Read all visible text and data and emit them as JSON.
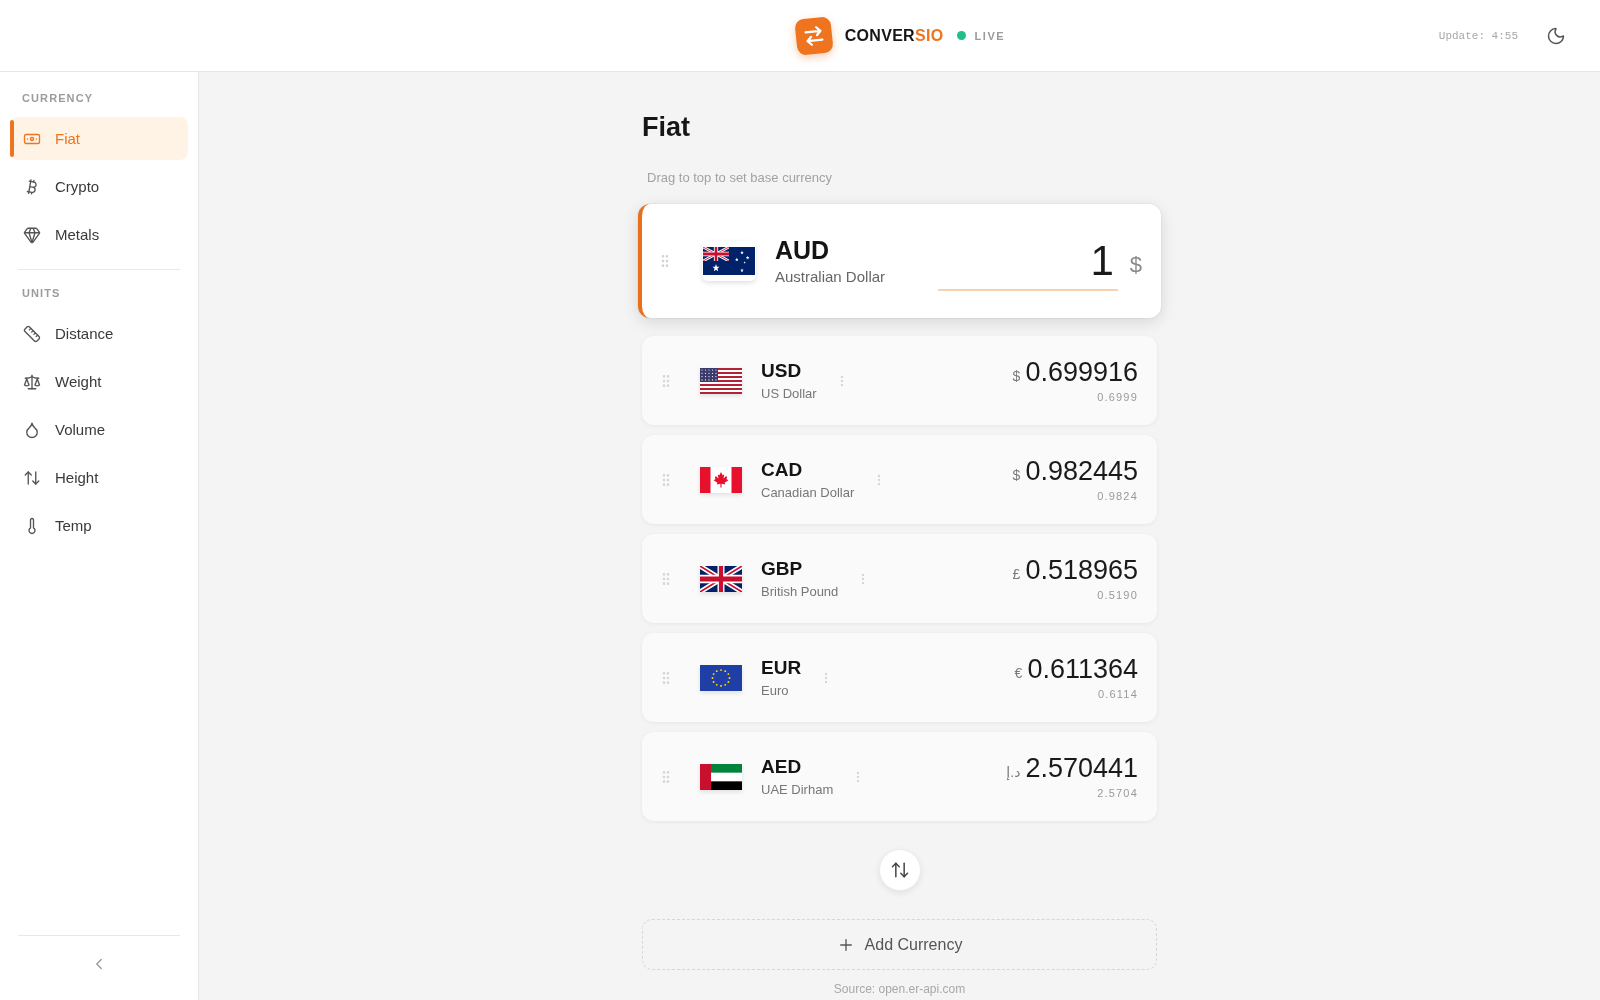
{
  "header": {
    "brand": {
      "text": "CONVER",
      "accent": "SIO"
    },
    "status": {
      "label": "LIVE",
      "on": true
    },
    "update": "Update: 4:55"
  },
  "sidebar": {
    "sections": [
      {
        "title": "CURRENCY",
        "items": [
          {
            "label": "Fiat",
            "selected": true
          },
          {
            "label": "Crypto",
            "selected": false
          },
          {
            "label": "Metals",
            "selected": false
          }
        ]
      },
      {
        "title": "UNITS",
        "items": [
          {
            "label": "Distance",
            "selected": false
          },
          {
            "label": "Weight",
            "selected": false
          },
          {
            "label": "Volume",
            "selected": false
          },
          {
            "label": "Height",
            "selected": false
          },
          {
            "label": "Temp",
            "selected": false
          }
        ]
      }
    ]
  },
  "main": {
    "title": "Fiat",
    "hint": "Drag to top to set base currency",
    "base_currency": {
      "code": "AUD",
      "name": "Australian Dollar",
      "amount": "1",
      "symbol": "$"
    },
    "currencies": [
      {
        "code": "USD",
        "name": "US Dollar",
        "symbol": "$",
        "value": "0.699916",
        "rate": "0.6999"
      },
      {
        "code": "CAD",
        "name": "Canadian Dollar",
        "symbol": "$",
        "value": "0.982445",
        "rate": "0.9824"
      },
      {
        "code": "GBP",
        "name": "British Pound",
        "symbol": "£",
        "value": "0.518965",
        "rate": "0.5190"
      },
      {
        "code": "EUR",
        "name": "Euro",
        "symbol": "€",
        "value": "0.611364",
        "rate": "0.6114"
      },
      {
        "code": "AED",
        "name": "UAE Dirham",
        "symbol": "د.إ",
        "value": "2.570441",
        "rate": "2.5704"
      }
    ],
    "add_button": "Add Currency",
    "source": "Source: open.er-api.com"
  }
}
